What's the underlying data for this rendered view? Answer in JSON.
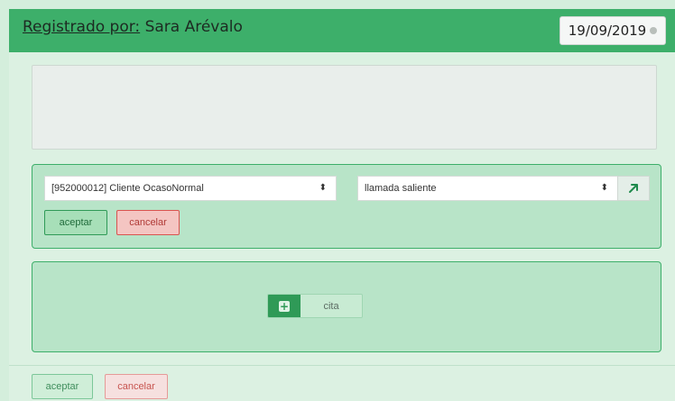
{
  "header": {
    "registered_label": "Registrado por:",
    "registered_name": "Sara Arévalo",
    "date": "19/09/2019"
  },
  "form": {
    "client_select": "[952000012] Cliente OcasoNormal",
    "call_type_select": "llamada saliente",
    "accept_label": "aceptar",
    "cancel_label": "cancelar"
  },
  "add_panel": {
    "add_label": "cita"
  },
  "footer": {
    "accept_label": "aceptar",
    "cancel_label": "cancelar"
  },
  "icons": {
    "date_clear": "clear-circle-icon",
    "external": "arrow-up-right-icon",
    "add": "plus-square-icon",
    "select_caret": "sort-caret-icon"
  },
  "colors": {
    "header_green": "#3daf6a",
    "panel_green": "#b8e4c8",
    "background": "#d4eedc",
    "accept": "#2f9a57",
    "cancel": "#d9534f"
  }
}
